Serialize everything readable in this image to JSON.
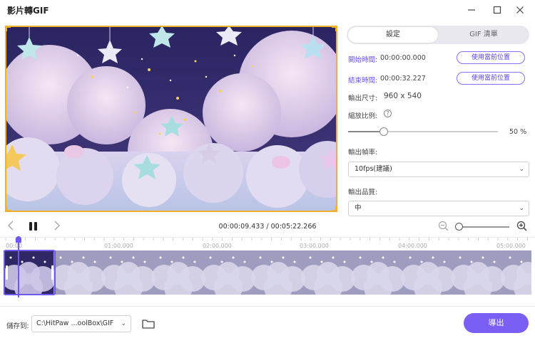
{
  "window": {
    "title": "影片轉GIF"
  },
  "tabs": [
    {
      "label": "設定"
    },
    {
      "label": "GIF 清單"
    }
  ],
  "settings": {
    "start_time_label": "開始時間:",
    "start_time_value": "00:00:00.000",
    "end_time_label": "結束時間:",
    "end_time_value": "00:00:32.227",
    "use_current_label": "使用當前位置",
    "output_size_label": "輸出尺寸:",
    "output_size_value": "960 x 540",
    "scale_label": "縮放比例:",
    "scale_value": "50 %",
    "scale_percent": 50,
    "frame_rate_label": "輸出幀率:",
    "frame_rate_value": "10fps(建議)",
    "quality_label": "輸出品質:",
    "quality_value": "中"
  },
  "player": {
    "timecode": "00:00:09.433 / 00:05:22.266"
  },
  "timeline": {
    "ticks": [
      "00:00",
      "01:00.000",
      "02:00.000",
      "03:00.000",
      "04:00.000",
      "05:00.000"
    ]
  },
  "footer": {
    "save_label": "儲存到:",
    "save_path": "C:\\HitPaw ...oolBox\\GIF",
    "export_label": "導出"
  },
  "colors": {
    "accent": "#7b5ff5",
    "selection_border": "#f2b12b"
  }
}
